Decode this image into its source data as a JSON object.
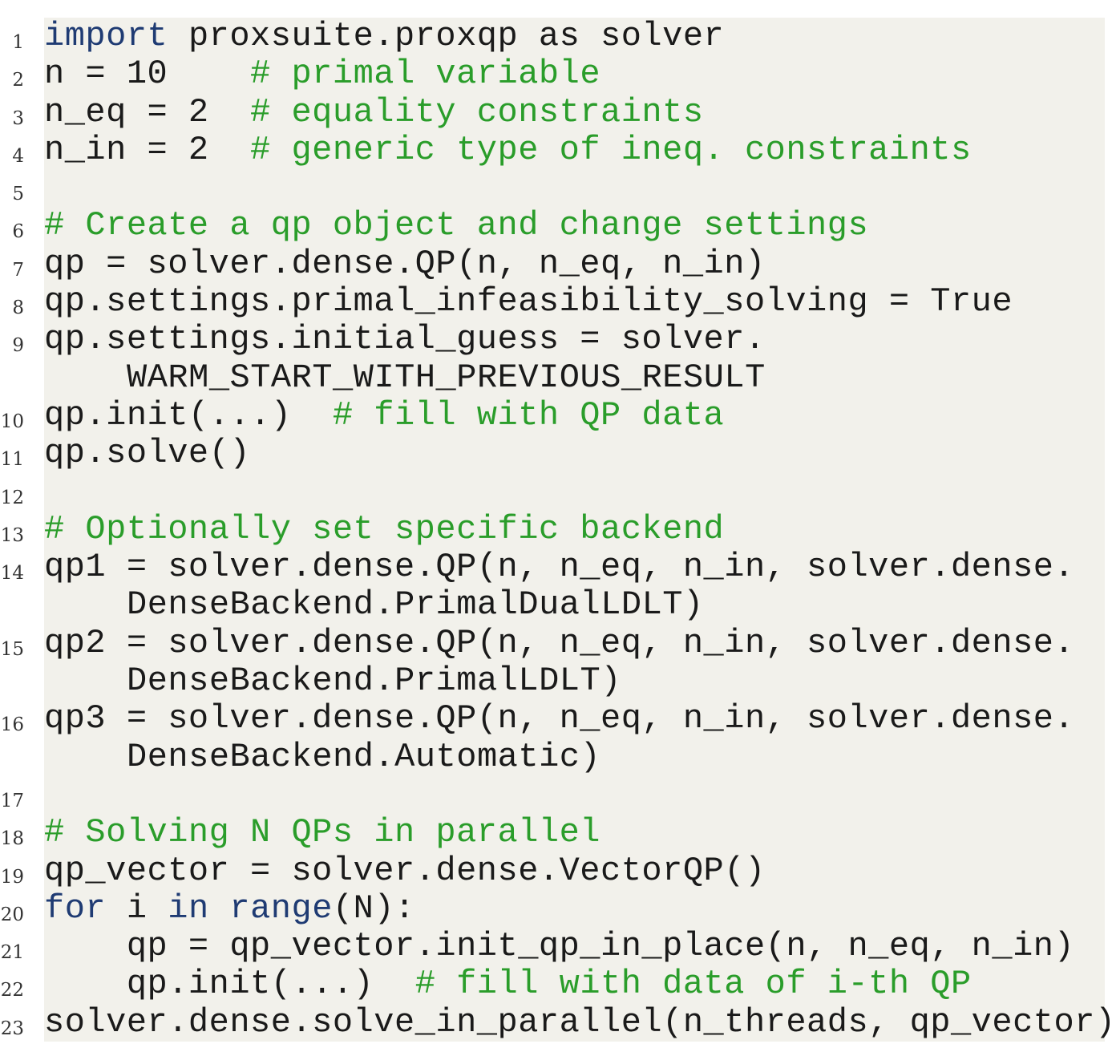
{
  "colors": {
    "background": "#f2f1eb",
    "keyword": "#1f3b73",
    "comment": "#2a9d2a",
    "text": "#1a1a1a",
    "line_number": "#333333"
  },
  "lines": [
    {
      "number": "1",
      "kw": "import",
      "code": " proxsuite.proxqp as solver",
      "comment": ""
    },
    {
      "number": "2",
      "code": "n = 10    ",
      "comment": "# primal variable"
    },
    {
      "number": "3",
      "code": "n_eq = 2  ",
      "comment": "# equality constraints"
    },
    {
      "number": "4",
      "code": "n_in = 2  ",
      "comment": "# generic type of ineq. constraints"
    },
    {
      "number": "5",
      "code": "",
      "comment": ""
    },
    {
      "number": "6",
      "code": "",
      "comment": "# Create a qp object and change settings"
    },
    {
      "number": "7",
      "code": "qp = solver.dense.QP(n, n_eq, n_in)",
      "comment": ""
    },
    {
      "number": "8",
      "code": "qp.settings.primal_infeasibility_solving = True",
      "comment": ""
    },
    {
      "number": "9",
      "code": "qp.settings.initial_guess = solver.",
      "cont": "WARM_START_WITH_PREVIOUS_RESULT"
    },
    {
      "number": "10",
      "code": "qp.init(...)  ",
      "comment": "# fill with QP data"
    },
    {
      "number": "11",
      "code": "qp.solve()",
      "comment": ""
    },
    {
      "number": "12",
      "code": "",
      "comment": ""
    },
    {
      "number": "13",
      "code": "",
      "comment": "# Optionally set specific backend"
    },
    {
      "number": "14",
      "code": "qp1 = solver.dense.QP(n, n_eq, n_in, solver.dense.",
      "cont": "DenseBackend.PrimalDualLDLT)"
    },
    {
      "number": "15",
      "code": "qp2 = solver.dense.QP(n, n_eq, n_in, solver.dense.",
      "cont": "DenseBackend.PrimalLDLT)"
    },
    {
      "number": "16",
      "code": "qp3 = solver.dense.QP(n, n_eq, n_in, solver.dense.",
      "cont": "DenseBackend.Automatic)"
    },
    {
      "number": "17",
      "code": "",
      "comment": ""
    },
    {
      "number": "18",
      "code": "",
      "comment": "# Solving N QPs in parallel"
    },
    {
      "number": "19",
      "code": "qp_vector = solver.dense.VectorQP()",
      "comment": ""
    },
    {
      "number": "20",
      "kw": "for",
      "code": " i ",
      "kw2": "in",
      "kw3": "range",
      "code2": "(N):"
    },
    {
      "number": "21",
      "code": "    qp = qp_vector.init_qp_in_place(n, n_eq, n_in)",
      "comment": ""
    },
    {
      "number": "22",
      "code": "    qp.init(...)  ",
      "comment": "# fill with data of i-th QP"
    },
    {
      "number": "23",
      "code": "solver.dense.solve_in_parallel(n_threads, qp_vector)",
      "comment": ""
    }
  ]
}
